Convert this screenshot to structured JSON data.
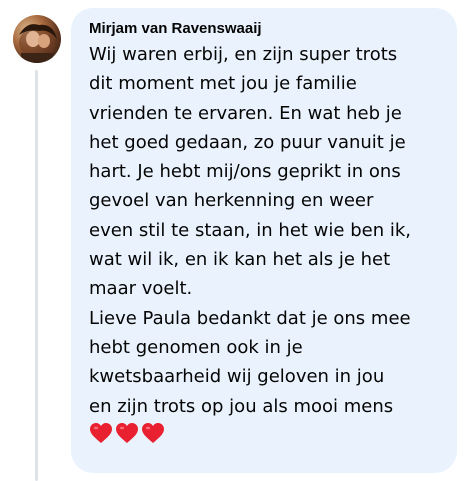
{
  "comment": {
    "author": "Mirjam van Ravenswaaij",
    "lines": [
      "Wij waren erbij, en zijn super trots",
      "dit moment met jou je familie",
      "vrienden te ervaren. En wat heb je",
      "het goed gedaan, zo puur vanuit je",
      "hart. Je hebt mij/ons geprikt in ons",
      "gevoel van herkenning en weer",
      "even stil te staan, in het wie ben ik,",
      "wat wil ik, en ik kan het als je het",
      "maar voelt.",
      "Lieve Paula bedankt dat je ons mee",
      "hebt genomen ook in je",
      "kwetsbaarheid wij geloven in jou",
      "en zijn trots op jou als mooi mens"
    ],
    "emoji": [
      "heart-emoji",
      "heart-emoji",
      "heart-emoji"
    ]
  },
  "colors": {
    "bubble": "#eaf3fd",
    "text": "#050505",
    "thread_line": "#dfe2e6",
    "heart": "#e8202f"
  }
}
